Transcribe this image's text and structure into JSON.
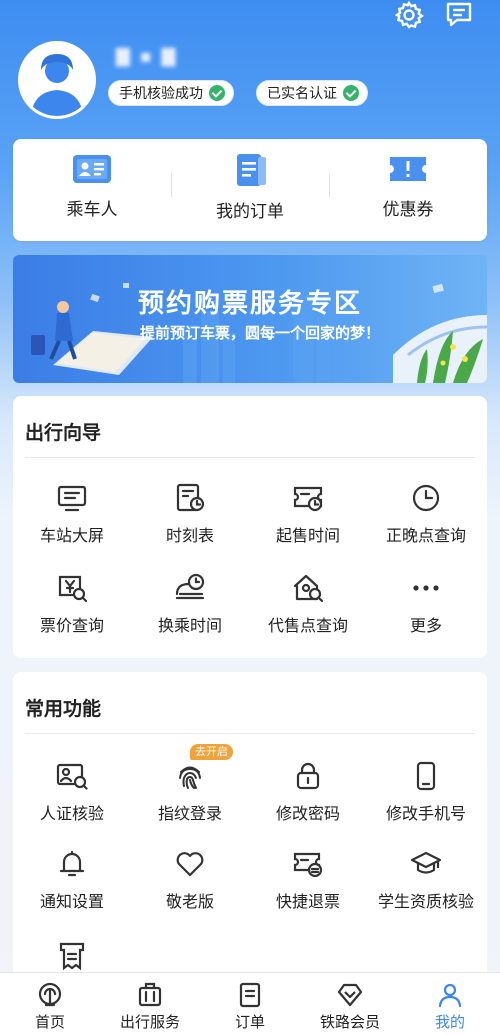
{
  "header": {
    "username": "▇ ▪ ▇",
    "badges": [
      {
        "label": "手机核验成功"
      },
      {
        "label": "已实名认证"
      }
    ]
  },
  "quick_actions": [
    {
      "label": "乘车人",
      "icon": "passenger-card-icon"
    },
    {
      "label": "我的订单",
      "icon": "order-icon"
    },
    {
      "label": "优惠券",
      "icon": "coupon-icon"
    }
  ],
  "banner": {
    "title": "预约购票服务专区",
    "subtitle": "提前预订车票，圆每一个回家的梦！"
  },
  "travel_guide": {
    "title": "出行向导",
    "items": [
      {
        "label": "车站大屏",
        "icon": "monitor-icon"
      },
      {
        "label": "时刻表",
        "icon": "timetable-icon"
      },
      {
        "label": "起售时间",
        "icon": "ticket-clock-icon"
      },
      {
        "label": "正晚点查询",
        "icon": "clock-icon"
      },
      {
        "label": "票价查询",
        "icon": "price-search-icon"
      },
      {
        "label": "换乘时间",
        "icon": "transfer-time-icon"
      },
      {
        "label": "代售点查询",
        "icon": "agency-search-icon"
      },
      {
        "label": "更多",
        "icon": "more-icon"
      }
    ]
  },
  "common_functions": {
    "title": "常用功能",
    "badge": "去开启",
    "items": [
      {
        "label": "人证核验",
        "icon": "id-verify-icon"
      },
      {
        "label": "指纹登录",
        "icon": "fingerprint-icon"
      },
      {
        "label": "修改密码",
        "icon": "lock-icon"
      },
      {
        "label": "修改手机号",
        "icon": "phone-icon"
      },
      {
        "label": "通知设置",
        "icon": "bell-icon"
      },
      {
        "label": "敬老版",
        "icon": "heart-icon"
      },
      {
        "label": "快捷退票",
        "icon": "quick-refund-icon"
      },
      {
        "label": "学生资质核验",
        "icon": "graduation-cap-icon"
      }
    ]
  },
  "tabbar": [
    {
      "label": "首页",
      "icon": "railway-logo-icon"
    },
    {
      "label": "出行服务",
      "icon": "luggage-icon"
    },
    {
      "label": "订单",
      "icon": "order-tab-icon"
    },
    {
      "label": "铁路会员",
      "icon": "diamond-icon"
    },
    {
      "label": "我的",
      "icon": "person-icon",
      "active": true
    }
  ],
  "colors": {
    "accent": "#3b86f0",
    "check_green": "#35b36b",
    "badge_orange": "#f0a33a"
  }
}
